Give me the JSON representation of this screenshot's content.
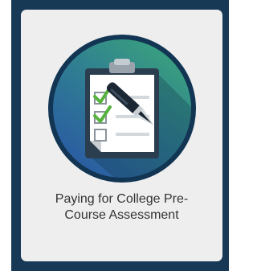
{
  "card": {
    "title_line1": "Paying for College Pre-",
    "title_line2": "Course Assessment",
    "icon": "clipboard-checklist-pen-icon"
  },
  "colors": {
    "page_frame": "#173956",
    "card_background": "#eeeeee",
    "circle_ring": "#123553",
    "circle_gradient_start": "#3aa27d",
    "circle_gradient_end": "#2a5aa3",
    "check_green": "#58b33e",
    "title_text": "#333333"
  }
}
